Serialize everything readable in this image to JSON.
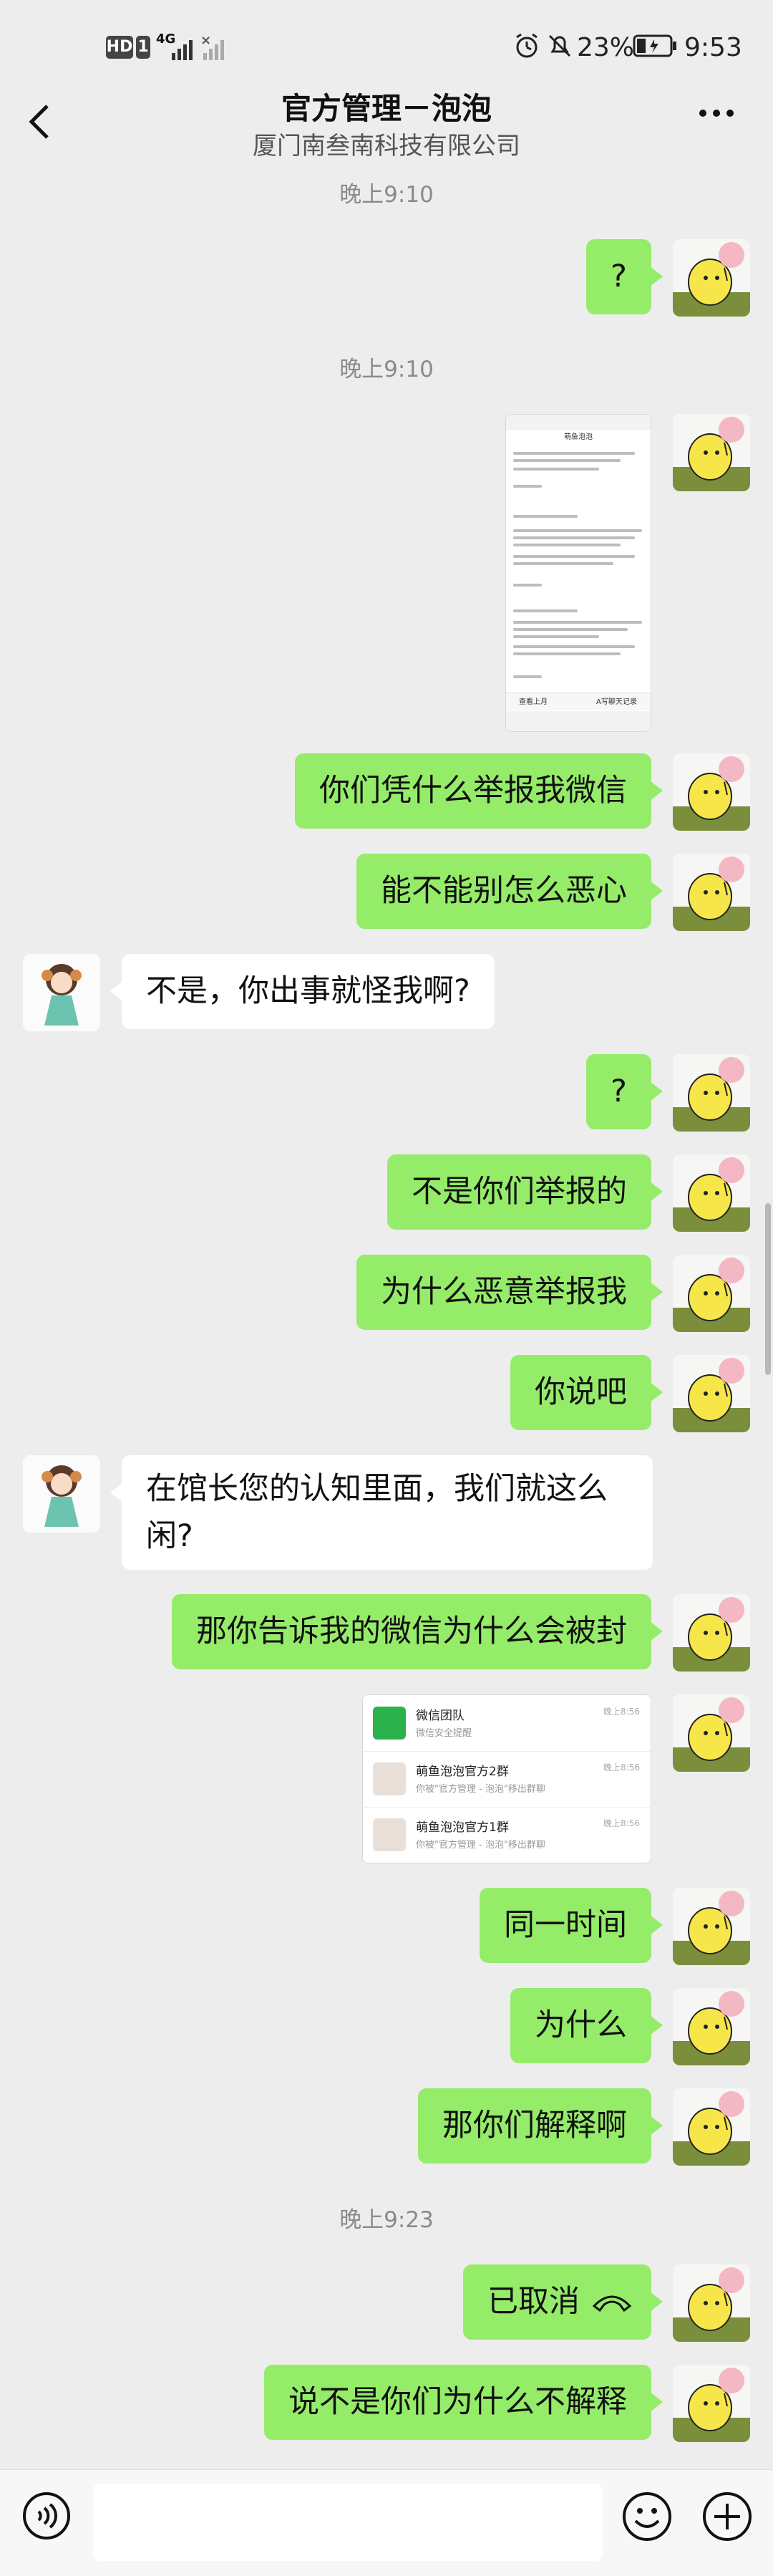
{
  "status_bar": {
    "hd": "HD",
    "sim": "1",
    "network": "4G",
    "battery": "23%",
    "time": "9:53"
  },
  "header": {
    "title": "官方管理－泡泡",
    "subtitle": "厦门南叁南科技有限公司",
    "back_icon": "chevron-left-icon",
    "more_icon": "more-dots-icon"
  },
  "messages": {
    "t1": "晚上9:10",
    "m1": "?",
    "t2": "晚上9:10",
    "m3": "你们凭什么举报我微信",
    "m4": "能不能别怎么恶心",
    "r1": "不是，你出事就怪我啊?",
    "m5": "?",
    "m6": "不是你们举报的",
    "m7": "为什么恶意举报我",
    "m8": "你说吧",
    "r2": "在馆长您的认知里面，我们就这么闲?",
    "m9": "那你告诉我的微信为什么会被封",
    "m10": "同一时间",
    "m11": "为什么",
    "m12": "那你们解释啊",
    "t3": "晚上9:23",
    "m13": "已取消",
    "m14": "说不是你们为什么不解释"
  },
  "shot1": {
    "title": "萌鱼泡泡",
    "btn_left": "查看上月",
    "btn_right": "A写聊天记录"
  },
  "shot2": {
    "rows": [
      {
        "name": "微信团队",
        "sub": "微信安全提醒",
        "time": "晚上8:56"
      },
      {
        "name": "萌鱼泡泡官方2群",
        "sub": "你被\"官方管理 - 泡泡\"移出群聊",
        "time": "晚上8:56"
      },
      {
        "name": "萌鱼泡泡官方1群",
        "sub": "你被\"官方管理 - 泡泡\"移出群聊",
        "time": "晚上8:56"
      }
    ]
  },
  "colors": {
    "bubble_me": "#95ec69",
    "bubble_them": "#ffffff",
    "background": "#ededed"
  }
}
